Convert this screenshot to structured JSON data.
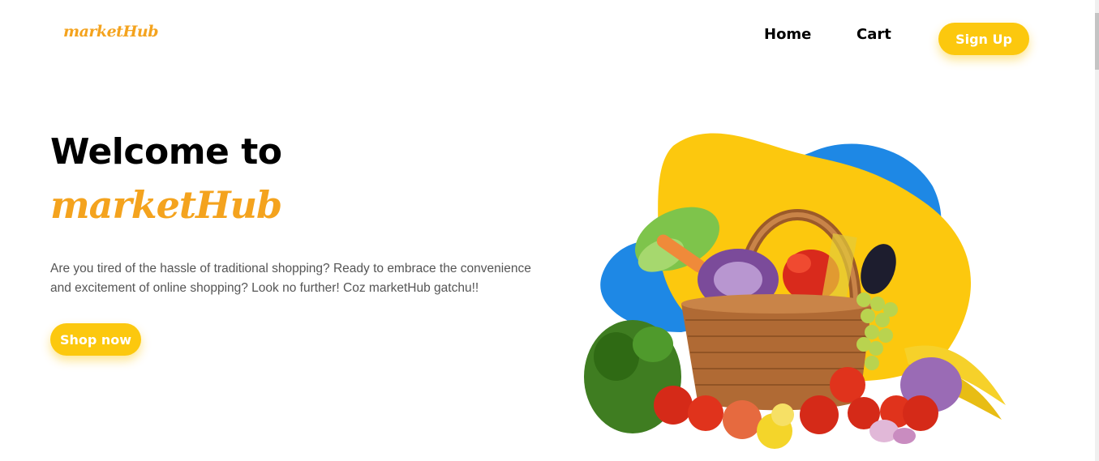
{
  "header": {
    "logo": "marketHub",
    "nav": {
      "home": "Home",
      "cart": "Cart"
    },
    "signup_label": "Sign Up"
  },
  "hero": {
    "title": "Welcome to",
    "brand": "marketHub",
    "description": "Are you tired of the hassle of traditional shopping? Ready to embrace the convenience and excitement of online shopping? Look no further! Coz marketHub gatchu!!",
    "cta_label": "Shop now"
  },
  "colors": {
    "brand_orange": "#f4a31e",
    "button_yellow": "#fcc80e",
    "blob_blue": "#1e88e5",
    "blob_yellow": "#fcc80e"
  },
  "icons": {
    "hero_image": "vegetable-basket-illustration"
  }
}
